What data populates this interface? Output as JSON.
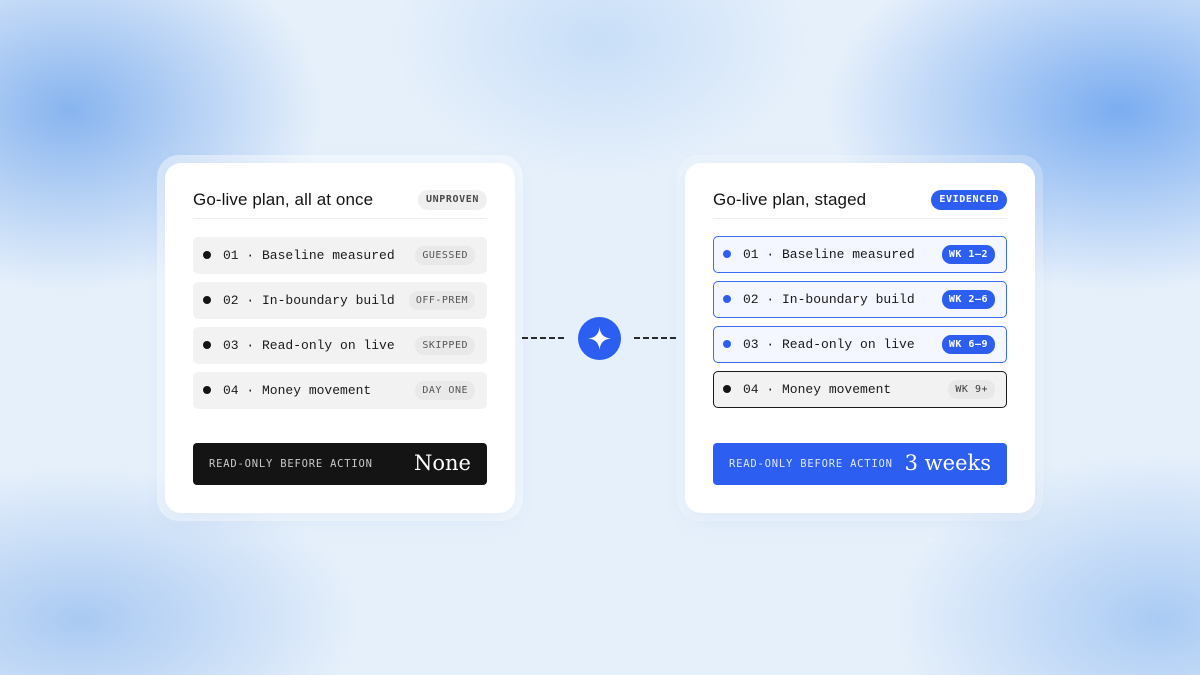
{
  "left_plan": {
    "title": "Go-live plan, all at once",
    "badge": "UNPROVEN",
    "steps": [
      {
        "label": "01 · Baseline measured",
        "tag": "GUESSED"
      },
      {
        "label": "02 · In-boundary build",
        "tag": "OFF-PREM"
      },
      {
        "label": "03 · Read-only on live",
        "tag": "SKIPPED"
      },
      {
        "label": "04 · Money movement",
        "tag": "DAY ONE"
      }
    ],
    "summary": {
      "label": "READ-ONLY BEFORE ACTION",
      "value": "None"
    }
  },
  "connector": {
    "icon": "sparkle-icon"
  },
  "right_plan": {
    "title": "Go-live plan, staged",
    "badge": "EVIDENCED",
    "steps": [
      {
        "label": "01 · Baseline measured",
        "tag": "WK 1–2"
      },
      {
        "label": "02 · In-boundary build",
        "tag": "WK 2–6"
      },
      {
        "label": "03 · Read-only on live",
        "tag": "WK 6–9"
      },
      {
        "label": "04 · Money movement",
        "tag": "WK 9+"
      }
    ],
    "summary": {
      "label": "READ-ONLY BEFORE ACTION",
      "value": "3 weeks"
    }
  },
  "colors": {
    "accent": "#2d5ef2",
    "dark": "#141414",
    "background": "#e6f0fb"
  }
}
